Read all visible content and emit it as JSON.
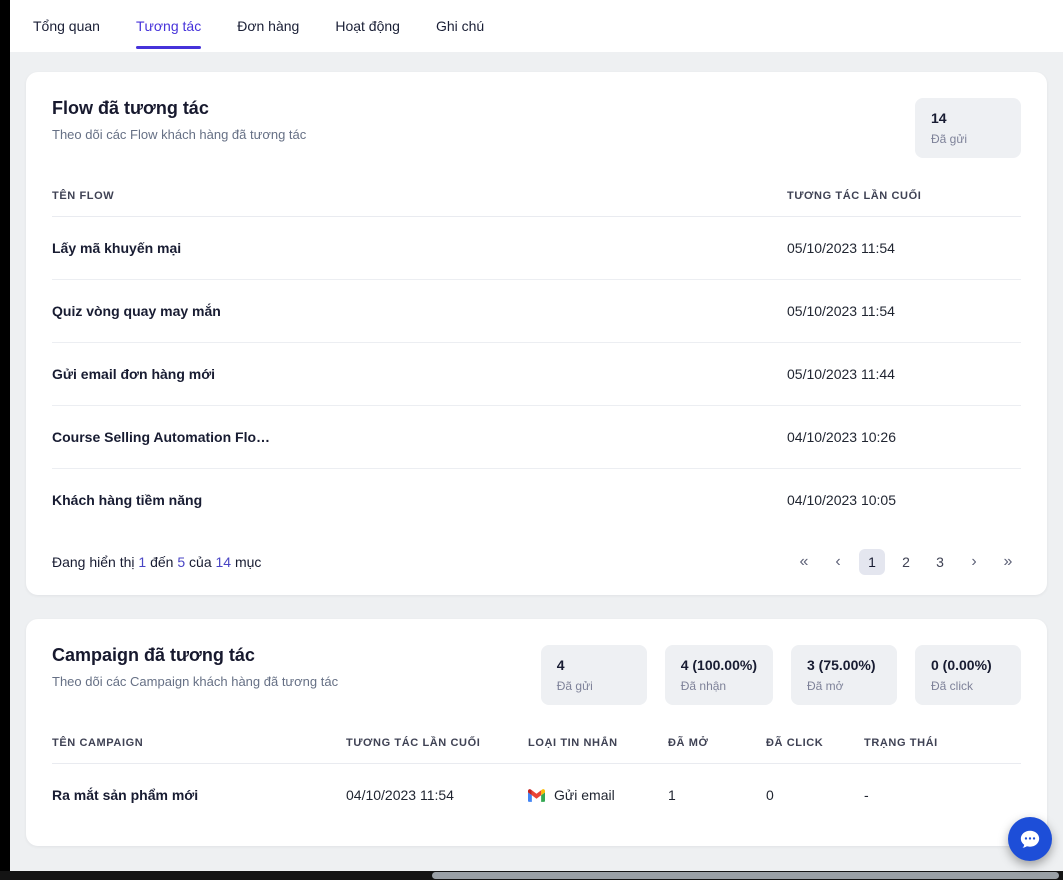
{
  "accent": "#4632da",
  "tabs": {
    "items": [
      {
        "label": "Tổng quan",
        "active": false
      },
      {
        "label": "Tương tác",
        "active": true
      },
      {
        "label": "Đơn hàng",
        "active": false
      },
      {
        "label": "Hoạt động",
        "active": false
      },
      {
        "label": "Ghi chú",
        "active": false
      }
    ]
  },
  "flow_section": {
    "title": "Flow đã tương tác",
    "subtitle": "Theo dõi các Flow khách hàng đã tương tác",
    "stats": [
      {
        "value": "14",
        "label": "Đã gửi"
      }
    ],
    "table": {
      "col_name": "TÊN FLOW",
      "col_last": "TƯƠNG TÁC LẦN CUỐI",
      "rows": [
        {
          "name": "Lấy mã khuyến mại",
          "last_interaction": "05/10/2023 11:54"
        },
        {
          "name": "Quiz vòng quay may mắn",
          "last_interaction": "05/10/2023 11:54"
        },
        {
          "name": "Gửi email đơn hàng mới",
          "last_interaction": "05/10/2023 11:44"
        },
        {
          "name": "Course Selling Automation Flo…",
          "last_interaction": "04/10/2023 10:26"
        },
        {
          "name": "Khách hàng tiềm năng",
          "last_interaction": "04/10/2023 10:05"
        }
      ]
    },
    "pagination": {
      "showing_prefix": "Đang hiển thị",
      "from": "1",
      "to_word": "đến",
      "to": "5",
      "of_word": "của",
      "total": "14",
      "items_word": "mục",
      "first_icon": "«",
      "prev_icon": "‹",
      "next_icon": "›",
      "last_icon": "»",
      "pages": [
        "1",
        "2",
        "3"
      ],
      "active_page": "1"
    }
  },
  "campaign_section": {
    "title": "Campaign đã tương tác",
    "subtitle": "Theo dõi các Campaign khách hàng đã tương tác",
    "stats": [
      {
        "value": "4",
        "label": "Đã gửi"
      },
      {
        "value": "4 (100.00%)",
        "label": "Đã nhận"
      },
      {
        "value": "3 (75.00%)",
        "label": "Đã mở"
      },
      {
        "value": "0 (0.00%)",
        "label": "Đã click"
      }
    ],
    "table": {
      "headers": [
        "TÊN CAMPAIGN",
        "TƯƠNG TÁC LẦN CUỐI",
        "LOẠI TIN NHẮN",
        "ĐÃ MỞ",
        "ĐÃ CLICK",
        "TRẠNG THÁI"
      ],
      "rows": [
        {
          "name": "Ra mắt sản phẩm mới",
          "last_interaction": "04/10/2023 11:54",
          "message_icon": "gmail",
          "message_type": "Gửi email",
          "opened": "1",
          "clicked": "0",
          "status": "-"
        }
      ]
    }
  }
}
